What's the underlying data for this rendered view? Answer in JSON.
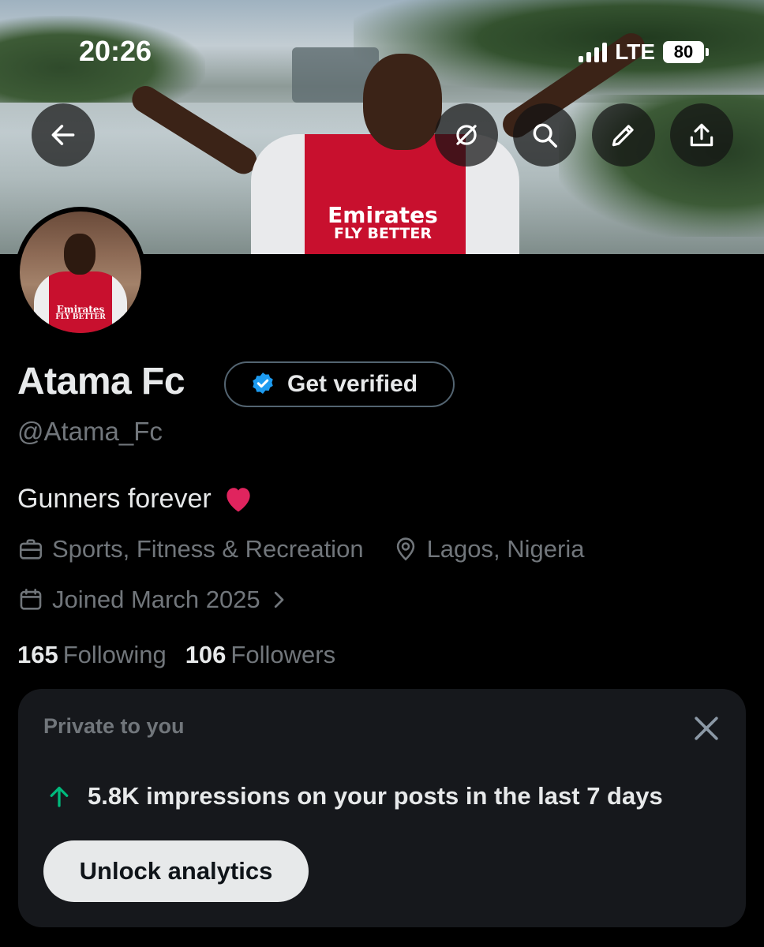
{
  "status_bar": {
    "time": "20:26",
    "network": "LTE",
    "battery": "80"
  },
  "header": {
    "back_icon": "arrow-left-icon",
    "grok_icon": "slashed-circle-icon",
    "search_icon": "search-icon",
    "edit_icon": "pencil-icon",
    "share_icon": "share-icon"
  },
  "banner": {
    "shirt_line1": "Emirates",
    "shirt_line2": "FLY BETTER"
  },
  "avatar": {
    "shirt_line1": "Emirates",
    "shirt_line2": "FLY BETTER"
  },
  "profile": {
    "name": "Atama Fc",
    "verify_label": "Get verified",
    "handle": "@Atama_Fc",
    "bio": "Gunners forever",
    "category": "Sports, Fitness & Recreation",
    "location": "Lagos, Nigeria",
    "joined": "Joined March 2025",
    "following_count": "165",
    "following_label": "Following",
    "followers_count": "106",
    "followers_label": "Followers"
  },
  "private_card": {
    "title": "Private to you",
    "impressions_text": "5.8K impressions on your posts in the last 7 days",
    "button_label": "Unlock analytics"
  },
  "colors": {
    "background": "#000000",
    "text_primary": "#e7e9ea",
    "text_secondary": "#71767b",
    "verified_blue": "#1d9bf0",
    "up_arrow_green": "#00ba7c",
    "heart_red": "#e0245e",
    "card_bg": "#16181c"
  }
}
